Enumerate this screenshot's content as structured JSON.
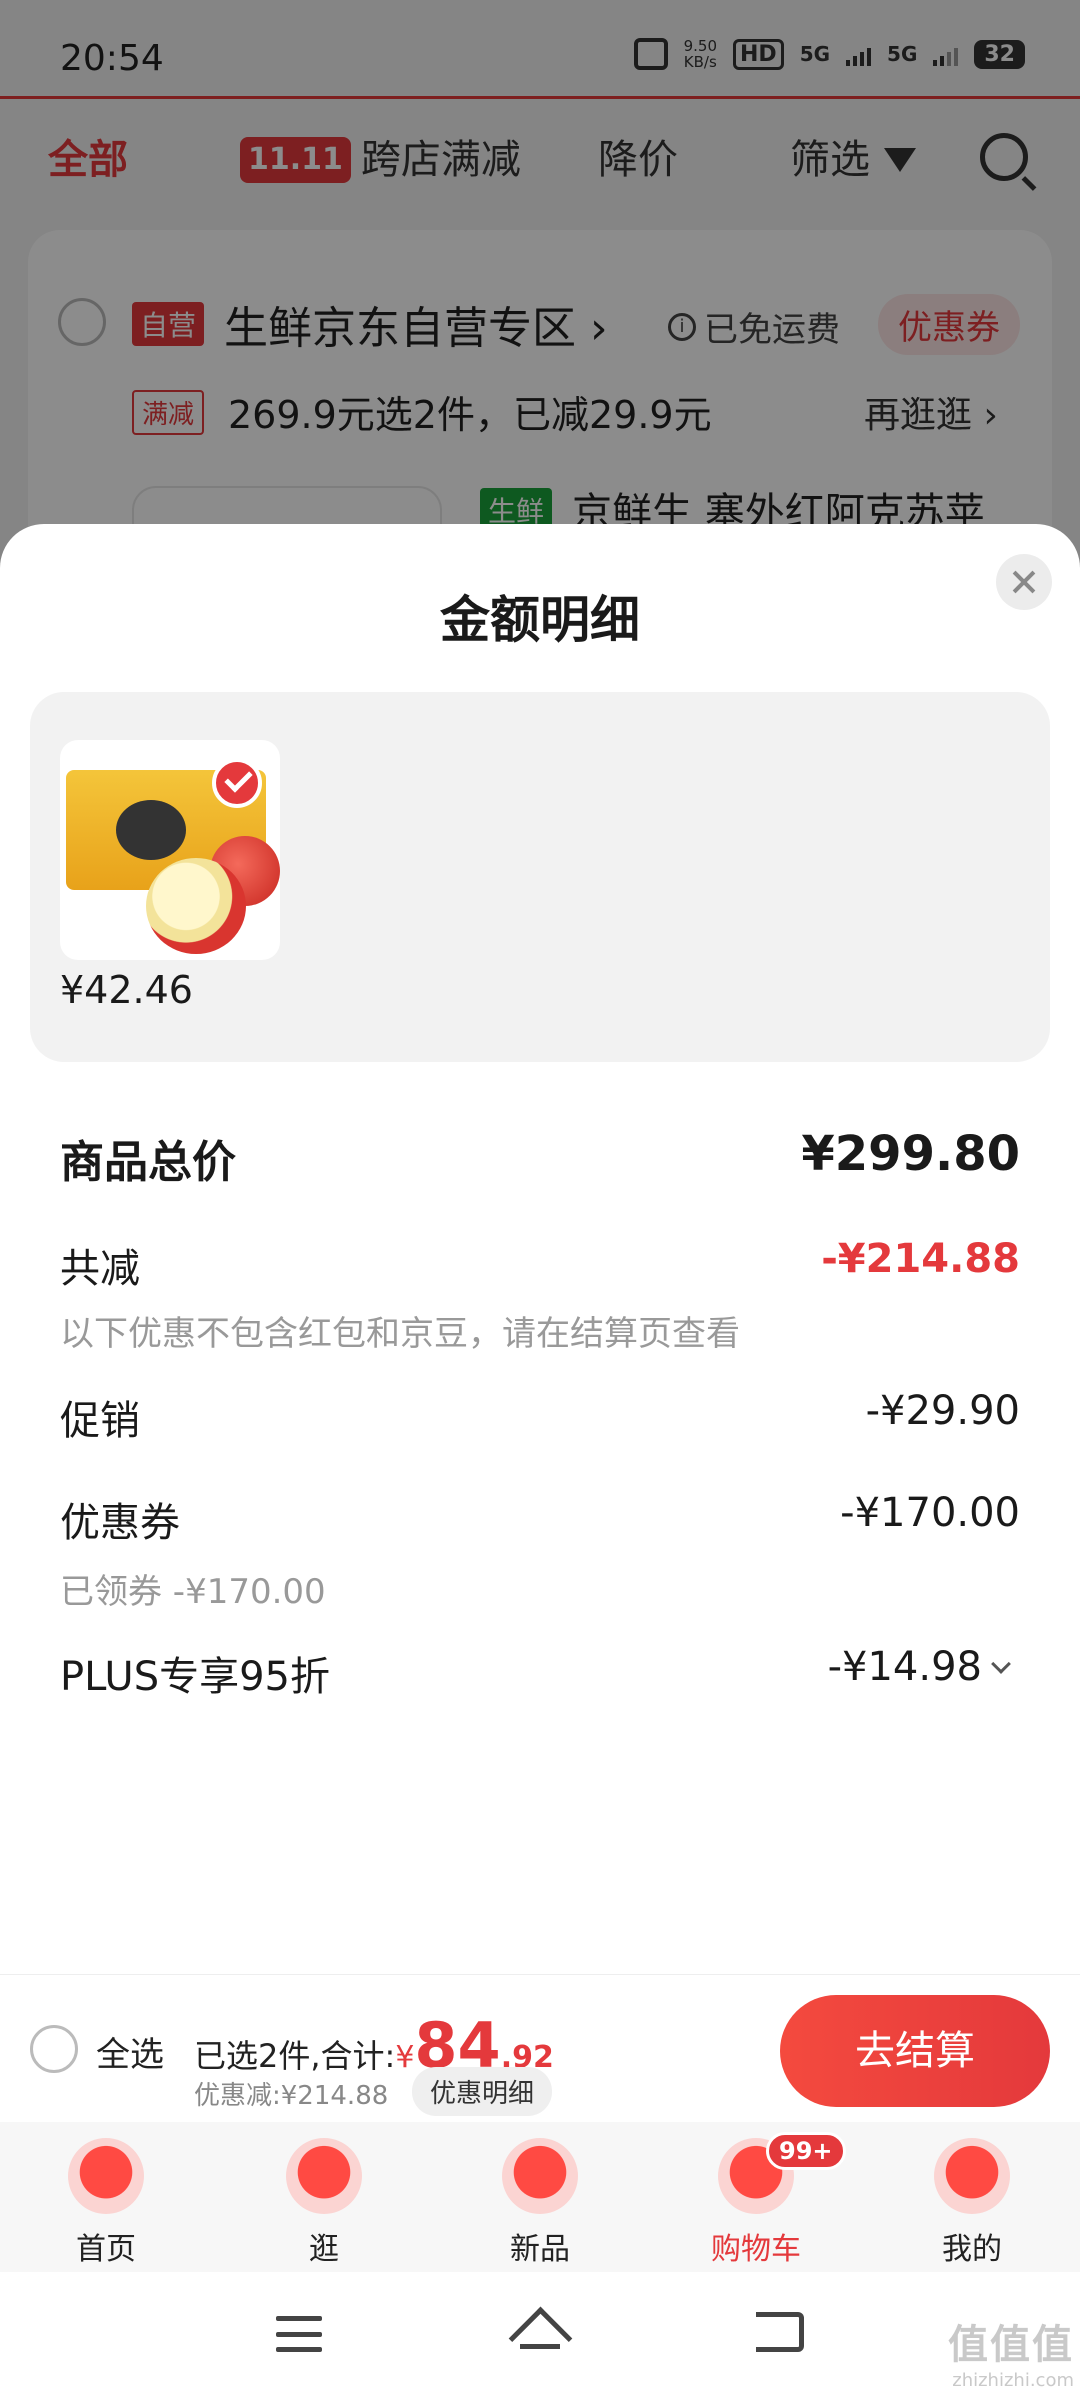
{
  "status_bar": {
    "time": "20:54",
    "speed_value": "9.50",
    "speed_unit": "KB/s",
    "hd_label": "HD",
    "network1": "5G",
    "network2": "5G",
    "battery": "32"
  },
  "cart_tabs": {
    "all": "全部",
    "cross_badge": "11.11",
    "cross_label": "跨店满减",
    "price_drop": "降价",
    "filter": "筛选"
  },
  "shop": {
    "self_tag": "自营",
    "name": "生鲜京东自营专区 ›",
    "free_shipping": "已免运费",
    "coupon": "优惠券",
    "promo_tag": "满减",
    "promo_text": "269.9元选2件，已减29.9元",
    "promo_more": "再逛逛 ›",
    "fresh_tag": "生鲜",
    "product_name": "京鲜生 塞外红阿克苏苹"
  },
  "sheet": {
    "title": "金额明细",
    "item_price": "¥42.46",
    "rows": {
      "total_label": "商品总价",
      "total_value": "¥299.80",
      "discount_label": "共减",
      "discount_value": "-¥214.88",
      "note": "以下优惠不包含红包和京豆，请在结算页查看",
      "promo_label": "促销",
      "promo_value": "-¥29.90",
      "coupon_label": "优惠券",
      "coupon_value": "-¥170.00",
      "coupon_sub": "已领券 -¥170.00",
      "plus_label": "PLUS专享95折",
      "plus_value": "-¥14.98"
    }
  },
  "checkout": {
    "select_all": "全选",
    "selected_text": "已选2件,合计:",
    "yen": "¥",
    "amount_big": "84",
    "amount_small": ".92",
    "saving": "优惠减:¥214.88",
    "detail": "优惠明细",
    "pay": "去结算"
  },
  "tabbar": {
    "home": "首页",
    "browse": "逛",
    "new": "新品",
    "cart": "购物车",
    "cart_badge": "99+",
    "me": "我的"
  },
  "watermark": {
    "top": "值值值",
    "bottom": "zhizhizhi.com"
  },
  "colors": {
    "accent": "#e4393c",
    "fresh": "#1aa33b"
  }
}
